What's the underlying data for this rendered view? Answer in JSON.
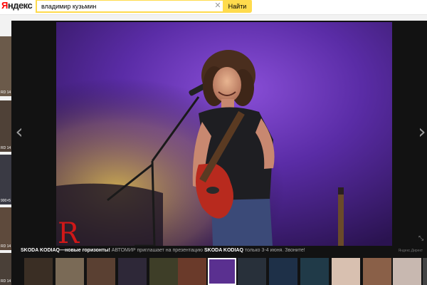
{
  "header": {
    "logo_text": "Яндекс",
    "search_value": "владимир кузьмин",
    "search_button_label": "Найти",
    "clear_icon": "close-icon"
  },
  "background_results": {
    "labels": [
      "RD 14",
      "RD 14",
      "900×5",
      "RD 14",
      "RD 14"
    ]
  },
  "viewer": {
    "prev_icon": "chevron-left-icon",
    "next_icon": "chevron-right-icon",
    "image_alt": "Guitarist performing on stage with microphone",
    "ad": {
      "brand": "SKODA KODIAQ—новые горизонты!",
      "text_1": "АВТОМИР приглашает на презентацию",
      "brand_2": "SKODA KODIAQ",
      "text_2": "только 3-4 июня. Звоните!",
      "source": "Яндекс.Директ"
    },
    "selected_thumb_index": 7,
    "thumbnails": [
      "thumb-1",
      "thumb-2",
      "thumb-3",
      "thumb-4",
      "thumb-5",
      "thumb-6",
      "thumb-7",
      "thumb-8",
      "thumb-9",
      "thumb-10",
      "thumb-11",
      "thumb-12",
      "thumb-13",
      "thumb-14"
    ]
  },
  "colors": {
    "search_accent": "#ffdb4d",
    "viewer_bg": "#121212",
    "logo_red": "#ff0000"
  }
}
